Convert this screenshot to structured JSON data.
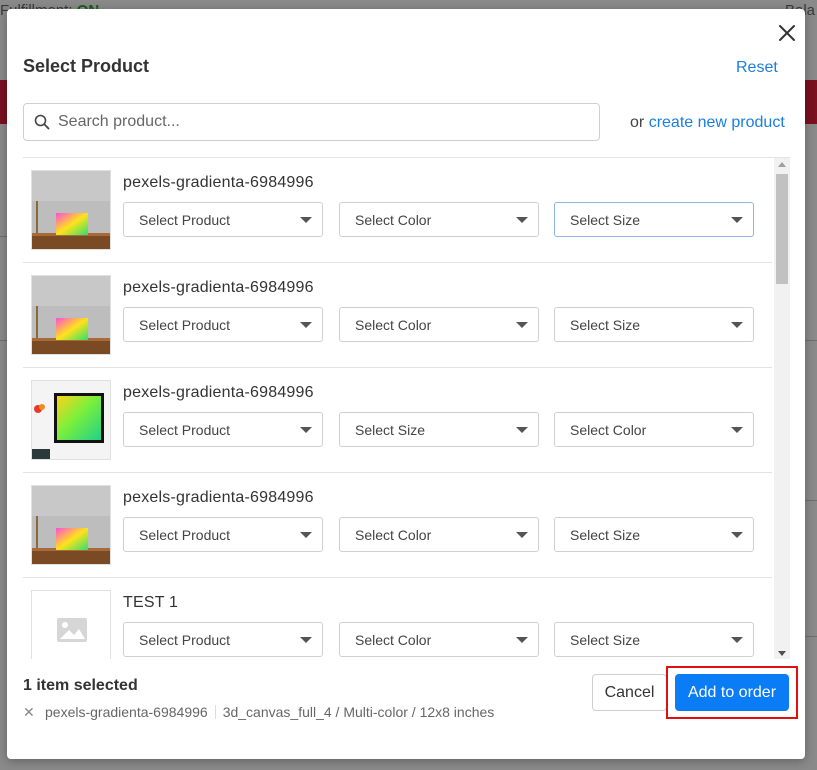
{
  "background": {
    "top_left_label": "Fulfillment:",
    "top_left_value": "ON",
    "top_right_label": "Bala"
  },
  "modal": {
    "title": "Select Product",
    "reset_label": "Reset",
    "search_placeholder": "Search product...",
    "create_prefix": "or",
    "create_link": "create new product"
  },
  "rows": [
    {
      "name": "pexels-gradienta-6984996",
      "thumb": "canvas-on-shelf",
      "selects": [
        "Select Product",
        "Select Color",
        "Select Size"
      ]
    },
    {
      "name": "pexels-gradienta-6984996",
      "thumb": "canvas-on-shelf",
      "selects": [
        "Select Product",
        "Select Color",
        "Select Size"
      ]
    },
    {
      "name": "pexels-gradienta-6984996",
      "thumb": "framed-print-on-wall",
      "selects": [
        "Select Product",
        "Select Size",
        "Select Color"
      ]
    },
    {
      "name": "pexels-gradienta-6984996",
      "thumb": "canvas-on-shelf",
      "selects": [
        "Select Product",
        "Select Color",
        "Select Size"
      ]
    },
    {
      "name": "TEST 1",
      "thumb": "image-placeholder",
      "selects": [
        "Select Product",
        "Select Color",
        "Select Size"
      ]
    }
  ],
  "footer": {
    "selected_count": "1 item selected",
    "chip_name": "pexels-gradienta-6984996",
    "chip_variant": "3d_canvas_full_4 / Multi-color / 12x8 inches",
    "cancel_label": "Cancel",
    "add_label": "Add to order"
  },
  "colors": {
    "accent": "#0a7cf5",
    "link": "#1a7fe0",
    "highlight": "#e01010"
  }
}
